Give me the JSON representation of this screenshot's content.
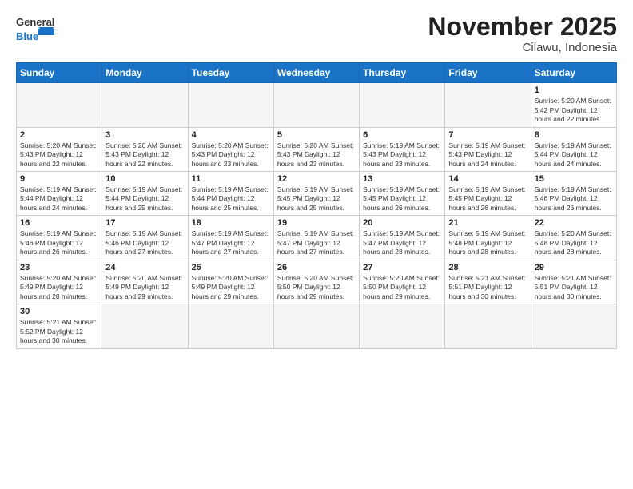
{
  "header": {
    "logo_general": "General",
    "logo_blue": "Blue",
    "month_title": "November 2025",
    "location": "Cilawu, Indonesia"
  },
  "weekdays": [
    "Sunday",
    "Monday",
    "Tuesday",
    "Wednesday",
    "Thursday",
    "Friday",
    "Saturday"
  ],
  "weeks": [
    [
      {
        "day": "",
        "info": ""
      },
      {
        "day": "",
        "info": ""
      },
      {
        "day": "",
        "info": ""
      },
      {
        "day": "",
        "info": ""
      },
      {
        "day": "",
        "info": ""
      },
      {
        "day": "",
        "info": ""
      },
      {
        "day": "1",
        "info": "Sunrise: 5:20 AM\nSunset: 5:42 PM\nDaylight: 12 hours\nand 22 minutes."
      }
    ],
    [
      {
        "day": "2",
        "info": "Sunrise: 5:20 AM\nSunset: 5:43 PM\nDaylight: 12 hours\nand 22 minutes."
      },
      {
        "day": "3",
        "info": "Sunrise: 5:20 AM\nSunset: 5:43 PM\nDaylight: 12 hours\nand 22 minutes."
      },
      {
        "day": "4",
        "info": "Sunrise: 5:20 AM\nSunset: 5:43 PM\nDaylight: 12 hours\nand 23 minutes."
      },
      {
        "day": "5",
        "info": "Sunrise: 5:20 AM\nSunset: 5:43 PM\nDaylight: 12 hours\nand 23 minutes."
      },
      {
        "day": "6",
        "info": "Sunrise: 5:19 AM\nSunset: 5:43 PM\nDaylight: 12 hours\nand 23 minutes."
      },
      {
        "day": "7",
        "info": "Sunrise: 5:19 AM\nSunset: 5:43 PM\nDaylight: 12 hours\nand 24 minutes."
      },
      {
        "day": "8",
        "info": "Sunrise: 5:19 AM\nSunset: 5:44 PM\nDaylight: 12 hours\nand 24 minutes."
      }
    ],
    [
      {
        "day": "9",
        "info": "Sunrise: 5:19 AM\nSunset: 5:44 PM\nDaylight: 12 hours\nand 24 minutes."
      },
      {
        "day": "10",
        "info": "Sunrise: 5:19 AM\nSunset: 5:44 PM\nDaylight: 12 hours\nand 25 minutes."
      },
      {
        "day": "11",
        "info": "Sunrise: 5:19 AM\nSunset: 5:44 PM\nDaylight: 12 hours\nand 25 minutes."
      },
      {
        "day": "12",
        "info": "Sunrise: 5:19 AM\nSunset: 5:45 PM\nDaylight: 12 hours\nand 25 minutes."
      },
      {
        "day": "13",
        "info": "Sunrise: 5:19 AM\nSunset: 5:45 PM\nDaylight: 12 hours\nand 26 minutes."
      },
      {
        "day": "14",
        "info": "Sunrise: 5:19 AM\nSunset: 5:45 PM\nDaylight: 12 hours\nand 26 minutes."
      },
      {
        "day": "15",
        "info": "Sunrise: 5:19 AM\nSunset: 5:46 PM\nDaylight: 12 hours\nand 26 minutes."
      }
    ],
    [
      {
        "day": "16",
        "info": "Sunrise: 5:19 AM\nSunset: 5:46 PM\nDaylight: 12 hours\nand 26 minutes."
      },
      {
        "day": "17",
        "info": "Sunrise: 5:19 AM\nSunset: 5:46 PM\nDaylight: 12 hours\nand 27 minutes."
      },
      {
        "day": "18",
        "info": "Sunrise: 5:19 AM\nSunset: 5:47 PM\nDaylight: 12 hours\nand 27 minutes."
      },
      {
        "day": "19",
        "info": "Sunrise: 5:19 AM\nSunset: 5:47 PM\nDaylight: 12 hours\nand 27 minutes."
      },
      {
        "day": "20",
        "info": "Sunrise: 5:19 AM\nSunset: 5:47 PM\nDaylight: 12 hours\nand 28 minutes."
      },
      {
        "day": "21",
        "info": "Sunrise: 5:19 AM\nSunset: 5:48 PM\nDaylight: 12 hours\nand 28 minutes."
      },
      {
        "day": "22",
        "info": "Sunrise: 5:20 AM\nSunset: 5:48 PM\nDaylight: 12 hours\nand 28 minutes."
      }
    ],
    [
      {
        "day": "23",
        "info": "Sunrise: 5:20 AM\nSunset: 5:49 PM\nDaylight: 12 hours\nand 28 minutes."
      },
      {
        "day": "24",
        "info": "Sunrise: 5:20 AM\nSunset: 5:49 PM\nDaylight: 12 hours\nand 29 minutes."
      },
      {
        "day": "25",
        "info": "Sunrise: 5:20 AM\nSunset: 5:49 PM\nDaylight: 12 hours\nand 29 minutes."
      },
      {
        "day": "26",
        "info": "Sunrise: 5:20 AM\nSunset: 5:50 PM\nDaylight: 12 hours\nand 29 minutes."
      },
      {
        "day": "27",
        "info": "Sunrise: 5:20 AM\nSunset: 5:50 PM\nDaylight: 12 hours\nand 29 minutes."
      },
      {
        "day": "28",
        "info": "Sunrise: 5:21 AM\nSunset: 5:51 PM\nDaylight: 12 hours\nand 30 minutes."
      },
      {
        "day": "29",
        "info": "Sunrise: 5:21 AM\nSunset: 5:51 PM\nDaylight: 12 hours\nand 30 minutes."
      }
    ],
    [
      {
        "day": "30",
        "info": "Sunrise: 5:21 AM\nSunset: 5:52 PM\nDaylight: 12 hours\nand 30 minutes."
      },
      {
        "day": "",
        "info": ""
      },
      {
        "day": "",
        "info": ""
      },
      {
        "day": "",
        "info": ""
      },
      {
        "day": "",
        "info": ""
      },
      {
        "day": "",
        "info": ""
      },
      {
        "day": "",
        "info": ""
      }
    ]
  ]
}
